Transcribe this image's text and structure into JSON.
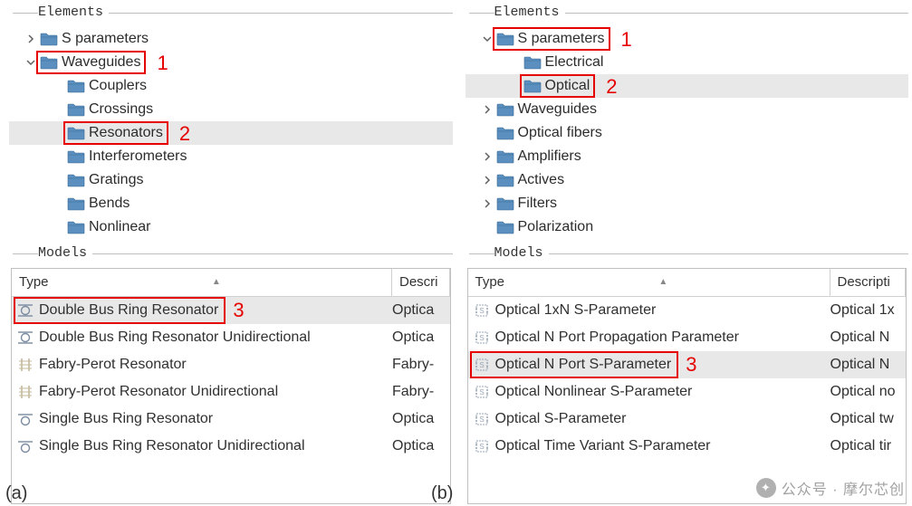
{
  "left": {
    "elements_title": "Elements",
    "models_title": "Models",
    "fig_label": "(a)",
    "tree": [
      {
        "indent": 0,
        "expander": "closed",
        "label": "S parameters"
      },
      {
        "indent": 0,
        "expander": "open",
        "label": "Waveguides",
        "highlight": 1
      },
      {
        "indent": 1,
        "expander": "none",
        "label": "Couplers"
      },
      {
        "indent": 1,
        "expander": "none",
        "label": "Crossings"
      },
      {
        "indent": 1,
        "expander": "none",
        "label": "Resonators",
        "highlight": 2,
        "selected": true
      },
      {
        "indent": 1,
        "expander": "none",
        "label": "Interferometers"
      },
      {
        "indent": 1,
        "expander": "none",
        "label": "Gratings"
      },
      {
        "indent": 1,
        "expander": "none",
        "label": "Bends"
      },
      {
        "indent": 1,
        "expander": "none",
        "label": "Nonlinear"
      }
    ],
    "columns": {
      "type": "Type",
      "desc": "Descri"
    },
    "rows": [
      {
        "icon": "ring-double",
        "type": "Double Bus Ring Resonator",
        "desc": "Optica",
        "highlight": 3,
        "selected": true
      },
      {
        "icon": "ring-double",
        "type": "Double Bus Ring Resonator Unidirectional",
        "desc": "Optica"
      },
      {
        "icon": "fabry",
        "type": "Fabry-Perot Resonator",
        "desc": "Fabry-"
      },
      {
        "icon": "fabry",
        "type": "Fabry-Perot Resonator Unidirectional",
        "desc": "Fabry-"
      },
      {
        "icon": "ring-single",
        "type": "Single Bus Ring Resonator",
        "desc": "Optica"
      },
      {
        "icon": "ring-single",
        "type": "Single Bus Ring Resonator Unidirectional",
        "desc": "Optica"
      }
    ]
  },
  "right": {
    "elements_title": "Elements",
    "models_title": "Models",
    "fig_label": "(b)",
    "tree": [
      {
        "indent": 0,
        "expander": "open",
        "label": "S parameters",
        "highlight": 1
      },
      {
        "indent": 1,
        "expander": "none",
        "label": "Electrical"
      },
      {
        "indent": 1,
        "expander": "none",
        "label": "Optical",
        "highlight": 2,
        "selected": true
      },
      {
        "indent": 0,
        "expander": "closed",
        "label": "Waveguides"
      },
      {
        "indent": 0,
        "expander": "none",
        "label": "Optical fibers"
      },
      {
        "indent": 0,
        "expander": "closed",
        "label": "Amplifiers"
      },
      {
        "indent": 0,
        "expander": "closed",
        "label": "Actives"
      },
      {
        "indent": 0,
        "expander": "closed",
        "label": "Filters"
      },
      {
        "indent": 0,
        "expander": "none",
        "label": "Polarization"
      }
    ],
    "columns": {
      "type": "Type",
      "desc": "Descripti"
    },
    "rows": [
      {
        "icon": "sparam",
        "type": "Optical 1xN S-Parameter",
        "desc": "Optical 1x"
      },
      {
        "icon": "sparam",
        "type": "Optical N Port Propagation Parameter",
        "desc": "Optical N"
      },
      {
        "icon": "sparam",
        "type": "Optical N Port S-Parameter",
        "desc": "Optical N",
        "highlight": 3,
        "selected": true
      },
      {
        "icon": "sparam",
        "type": "Optical Nonlinear S-Parameter",
        "desc": "Optical no"
      },
      {
        "icon": "sparam",
        "type": "Optical S-Parameter",
        "desc": "Optical tw"
      },
      {
        "icon": "sparam",
        "type": "Optical Time Variant S-Parameter",
        "desc": "Optical tir"
      }
    ]
  },
  "highlights": {
    "1": "1",
    "2": "2",
    "3": "3"
  },
  "watermark": "公众号 · 摩尔芯创"
}
